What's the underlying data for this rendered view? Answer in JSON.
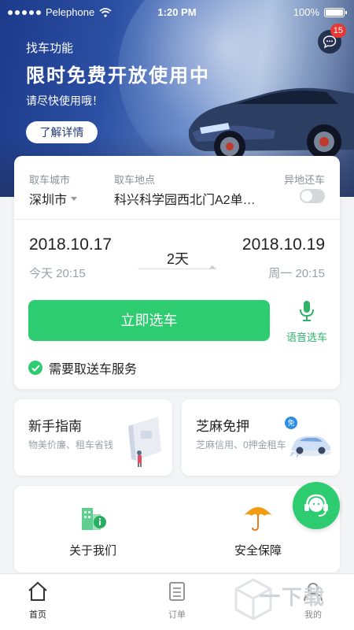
{
  "status_bar": {
    "carrier": "Pelephone",
    "time": "1:20 PM",
    "battery": "100%"
  },
  "header": {
    "message_badge": "15"
  },
  "banner": {
    "subtitle": "找车功能",
    "title": "限时免费开放使用中",
    "hint": "请尽快使用哦！",
    "detail_button": "了解详情"
  },
  "booking": {
    "city_label": "取车城市",
    "city_value": "深圳市",
    "location_label": "取车地点",
    "location_value": "科兴科学园西北门A2单…",
    "return_label": "异地还车",
    "return_toggle_on": false,
    "pickup_date": "2018.10.17",
    "pickup_time": "今天 20:15",
    "duration": "2天",
    "return_date": "2018.10.19",
    "return_time": "周一 20:15",
    "select_button": "立即选车",
    "voice_label": "语音选车",
    "delivery_label": "需要取送车服务"
  },
  "features": [
    {
      "title": "新手指南",
      "subtitle": "物美价廉、租车省钱"
    },
    {
      "title": "芝麻免押",
      "subtitle": "芝麻信用、0押金租车",
      "badge": "免"
    }
  ],
  "about": [
    {
      "label": "关于我们"
    },
    {
      "label": "安全保障"
    }
  ],
  "tabs": [
    {
      "label": "首页"
    },
    {
      "label": "订单"
    },
    {
      "label": "我的"
    }
  ],
  "watermark": "一下载",
  "colors": {
    "accent_green": "#2ecc71",
    "voice_green": "#2db46a",
    "badge_red": "#e53935",
    "umbrella_orange": "#f39c12"
  }
}
